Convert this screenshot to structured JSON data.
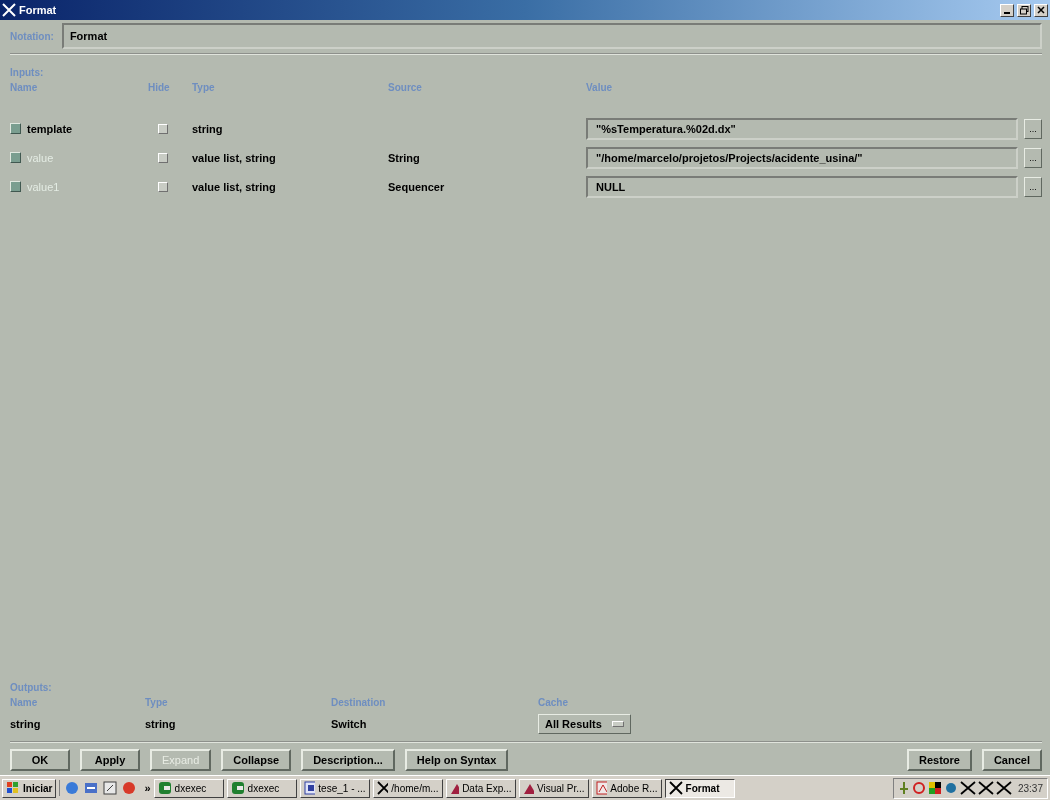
{
  "window": {
    "title": "Format"
  },
  "notation": {
    "label": "Notation:",
    "value": "Format"
  },
  "inputs": {
    "label": "Inputs:",
    "columns": [
      "Name",
      "Hide",
      "Type",
      "Source",
      "Value"
    ],
    "rows": [
      {
        "name": "template",
        "active": true,
        "hidden": false,
        "type": "string",
        "source": "",
        "value": "\"%sTemperatura.%02d.dx\"",
        "browse": "..."
      },
      {
        "name": "value",
        "active": false,
        "hidden": false,
        "type": "value list, string",
        "source": "String",
        "value": "\"/home/marcelo/projetos/Projects/acidente_usina/\"",
        "browse": "..."
      },
      {
        "name": "value1",
        "active": false,
        "hidden": false,
        "type": "value list, string",
        "source": "Sequencer",
        "value": "NULL",
        "browse": "..."
      }
    ]
  },
  "outputs": {
    "label": "Outputs:",
    "columns": [
      "Name",
      "Type",
      "Destination",
      "Cache"
    ],
    "rows": [
      {
        "name": "string",
        "type": "string",
        "destination": "Switch",
        "cache": "All Results"
      }
    ]
  },
  "buttons": [
    {
      "label": "OK",
      "disabled": false
    },
    {
      "label": "Apply",
      "disabled": false
    },
    {
      "label": "Expand",
      "disabled": true
    },
    {
      "label": "Collapse",
      "disabled": false
    },
    {
      "label": "Description...",
      "disabled": false
    },
    {
      "label": "Help on Syntax",
      "disabled": false
    },
    {
      "label": "Restore",
      "disabled": false
    },
    {
      "label": "Cancel",
      "disabled": false
    }
  ],
  "taskbar": {
    "start": "Iniciar",
    "more": "»",
    "tasks": [
      {
        "label": "dxexec",
        "kind": "dx",
        "selected": false
      },
      {
        "label": "dxexec",
        "kind": "dx",
        "selected": false
      },
      {
        "label": "tese_1 - ...",
        "kind": "doc",
        "selected": false
      },
      {
        "label": "/home/m...",
        "kind": "x",
        "selected": false
      },
      {
        "label": "Data Exp...",
        "kind": "vis",
        "selected": false
      },
      {
        "label": "Visual Pr...",
        "kind": "vis",
        "selected": false
      },
      {
        "label": "Adobe R...",
        "kind": "pdf",
        "selected": false
      },
      {
        "label": "Format",
        "kind": "x",
        "selected": true
      }
    ],
    "clock": "23:37"
  }
}
